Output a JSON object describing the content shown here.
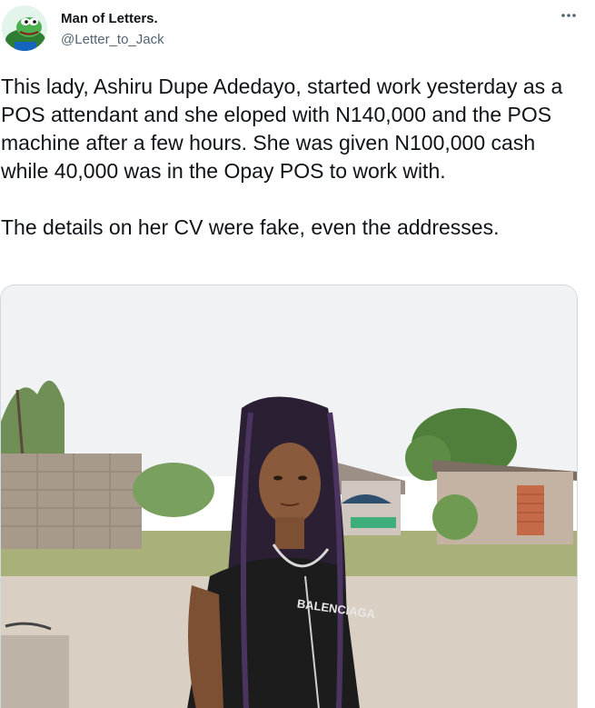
{
  "author": {
    "display_name": "Man of Letters.",
    "handle": "@Letter_to_Jack",
    "avatar_icon": "frog-avatar-icon"
  },
  "more_icon": "more-horizontal-icon",
  "tweet": {
    "paragraph_1": "This lady, Ashiru Dupe Adedayo, started work yesterday as a POS attendant and she eloped with N140,000 and the POS machine after a few hours. She was given N100,000 cash while 40,000 was in the Opay POS to work with.",
    "paragraph_2": "The details on her CV were fake, even the addresses."
  },
  "media": {
    "shirt_text": "BALENCIAGA"
  },
  "colors": {
    "text": "#0f1419",
    "secondary": "#536471",
    "border": "#cfd9de"
  }
}
